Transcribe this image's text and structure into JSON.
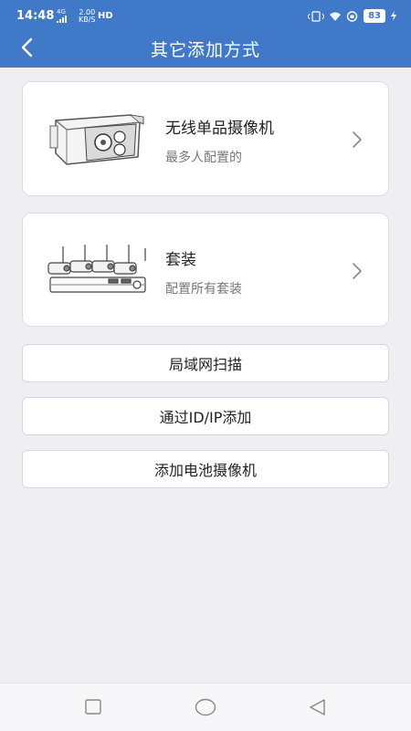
{
  "status": {
    "time": "14:48",
    "net_top": "4G",
    "speed_value": "2.00",
    "speed_unit": "KB/S",
    "hd": "HD",
    "battery": "83"
  },
  "header": {
    "title": "其它添加方式"
  },
  "options": [
    {
      "name": "无线单品摄像机",
      "desc": "最多人配置的"
    },
    {
      "name": "套装",
      "desc": "配置所有套装"
    }
  ],
  "buttons": [
    {
      "label": "局域网扫描"
    },
    {
      "label": "通过ID/IP添加"
    },
    {
      "label": "添加电池摄像机"
    }
  ],
  "icons": {
    "back": "back-arrow-icon",
    "chevron": "chevron-right-icon",
    "nav_recent": "square-icon",
    "nav_home": "circle-icon",
    "nav_back": "triangle-back-icon"
  },
  "colors": {
    "accent": "#3f79c8",
    "background": "#eeeef3"
  }
}
